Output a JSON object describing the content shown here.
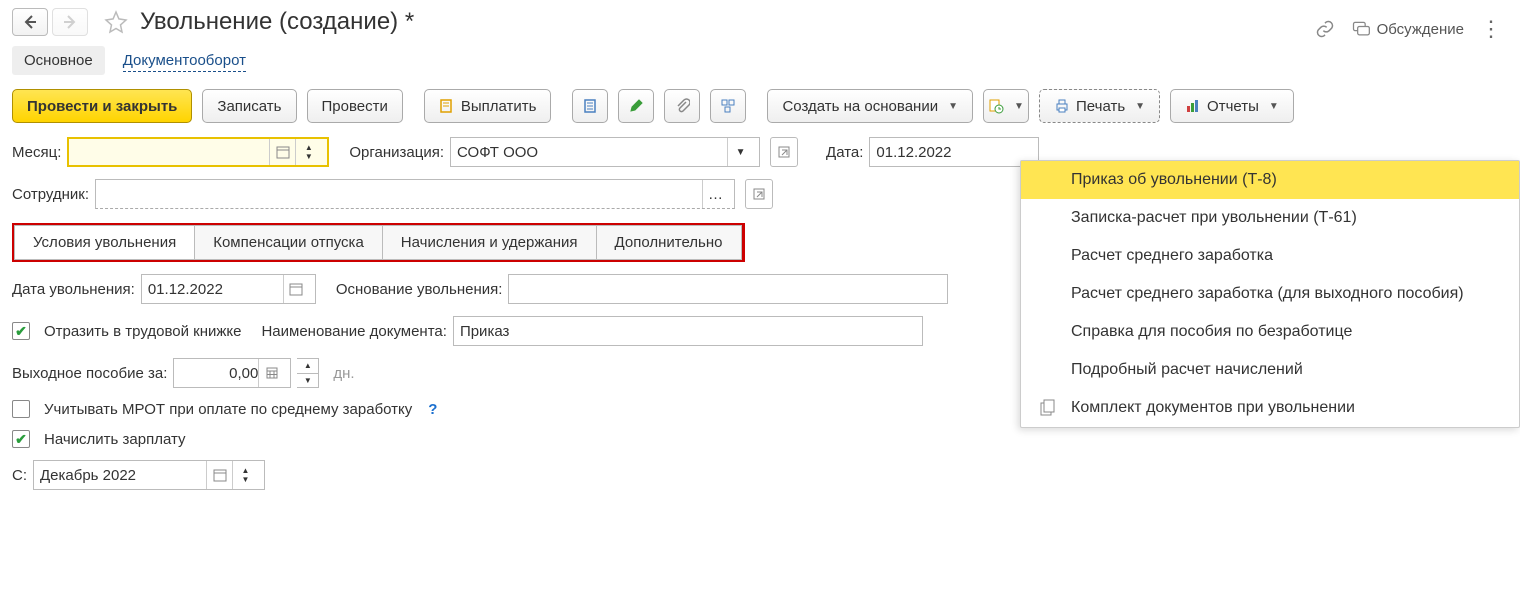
{
  "header": {
    "title": "Увольнение (создание) *",
    "discuss": "Обсуждение"
  },
  "nav": {
    "main": "Основное",
    "docflow": "Документооборот"
  },
  "toolbar": {
    "post_close": "Провести и закрыть",
    "save": "Записать",
    "post": "Провести",
    "pay": "Выплатить",
    "create_based": "Создать на основании",
    "print": "Печать",
    "reports": "Отчеты"
  },
  "form": {
    "month_label": "Месяц:",
    "month_value": "",
    "org_label": "Организация:",
    "org_value": "СОФТ ООО",
    "date_label": "Дата:",
    "date_value": "01.12.2022",
    "employee_label": "Сотрудник:",
    "employee_value": ""
  },
  "tabs": {
    "t1": "Условия увольнения",
    "t2": "Компенсации отпуска",
    "t3": "Начисления и удержания",
    "t4": "Дополнительно"
  },
  "details": {
    "dismissal_date_label": "Дата увольнения:",
    "dismissal_date_value": "01.12.2022",
    "basis_label": "Основание увольнения:",
    "basis_value": "",
    "workbook_label": "Отразить в трудовой книжке",
    "docname_label": "Наименование документа:",
    "docname_value": "Приказ",
    "severance_label": "Выходное пособие за:",
    "severance_value": "0,00",
    "severance_unit": "дн.",
    "mrot_label": "Учитывать МРОТ при оплате по среднему заработку",
    "accrue_label": "Начислить зарплату",
    "from_label": "С:",
    "from_value": "Декабрь 2022"
  },
  "print_menu": {
    "i1": "Приказ об увольнении (Т-8)",
    "i2": "Записка-расчет при увольнении (Т-61)",
    "i3": "Расчет среднего заработка",
    "i4": "Расчет среднего заработка (для выходного пособия)",
    "i5": "Справка для пособия по безработице",
    "i6": "Подробный расчет начислений",
    "i7": "Комплект документов при увольнении"
  }
}
